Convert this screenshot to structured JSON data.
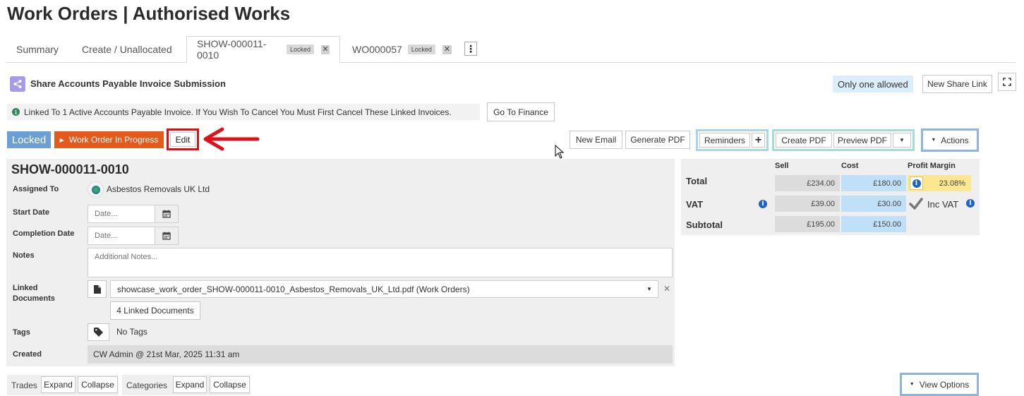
{
  "page": {
    "title": "Work Orders | Authorised Works"
  },
  "tabs": [
    {
      "label": "Summary"
    },
    {
      "label": "Create / Unallocated"
    },
    {
      "label": "SHOW-000011-0010",
      "badge": "Locked"
    },
    {
      "label": "WO000057",
      "badge": "Locked"
    }
  ],
  "share": {
    "title": "Share Accounts Payable Invoice Submission",
    "only_one": "Only one allowed",
    "new_link": "New Share Link"
  },
  "notice": {
    "text": "Linked To 1 Active Accounts Payable Invoice. If You Wish To Cancel You Must First Cancel These Linked Invoices.",
    "finance_button": "Go To Finance"
  },
  "status": {
    "locked": "Locked",
    "progress": "Work Order In Progress",
    "edit": "Edit"
  },
  "toolbar": {
    "new_email": "New Email",
    "generate_pdf": "Generate PDF",
    "reminders": "Reminders",
    "create_pdf": "Create PDF",
    "preview_pdf": "Preview PDF",
    "actions": "Actions"
  },
  "work_order": {
    "id": "SHOW-000011-0010",
    "assigned_to_label": "Assigned To",
    "assigned_to": "Asbestos Removals UK Ltd",
    "start_date_label": "Start Date",
    "start_date_placeholder": "Date...",
    "completion_date_label": "Completion Date",
    "completion_date_placeholder": "Date...",
    "notes_label": "Notes",
    "notes_placeholder": "Additional Notes...",
    "linked_docs_label_1": "Linked",
    "linked_docs_label_2": "Documents",
    "linked_doc_selected": "showcase_work_order_SHOW-000011-0010_Asbestos_Removals_UK_Ltd.pdf (Work Orders)",
    "linked_docs_count": "4 Linked Documents",
    "tags_label": "Tags",
    "tags_value": "No Tags",
    "created_label": "Created",
    "created_value": "CW Admin @ 21st Mar, 2025 11:31 am"
  },
  "financials": {
    "headers": {
      "sell": "Sell",
      "cost": "Cost",
      "margin": "Profit Margin"
    },
    "total_label": "Total",
    "total_sell": "£234.00",
    "total_cost": "£180.00",
    "margin": "23.08%",
    "vat_label": "VAT",
    "vat_sell": "£39.00",
    "vat_cost": "£30.00",
    "inc_vat": "Inc VAT",
    "subtotal_label": "Subtotal",
    "subtotal_sell": "£195.00",
    "subtotal_cost": "£150.00"
  },
  "bottom": {
    "trades": "Trades",
    "categories": "Categories",
    "expand": "Expand",
    "collapse": "Collapse",
    "view_options": "View Options"
  },
  "colors": {
    "locked": "#6c9fd4",
    "in_progress": "#e25a1c",
    "highlight": "#d9101a",
    "cost_cell": "#bfe0f7",
    "margin_cell": "#fbe792"
  }
}
